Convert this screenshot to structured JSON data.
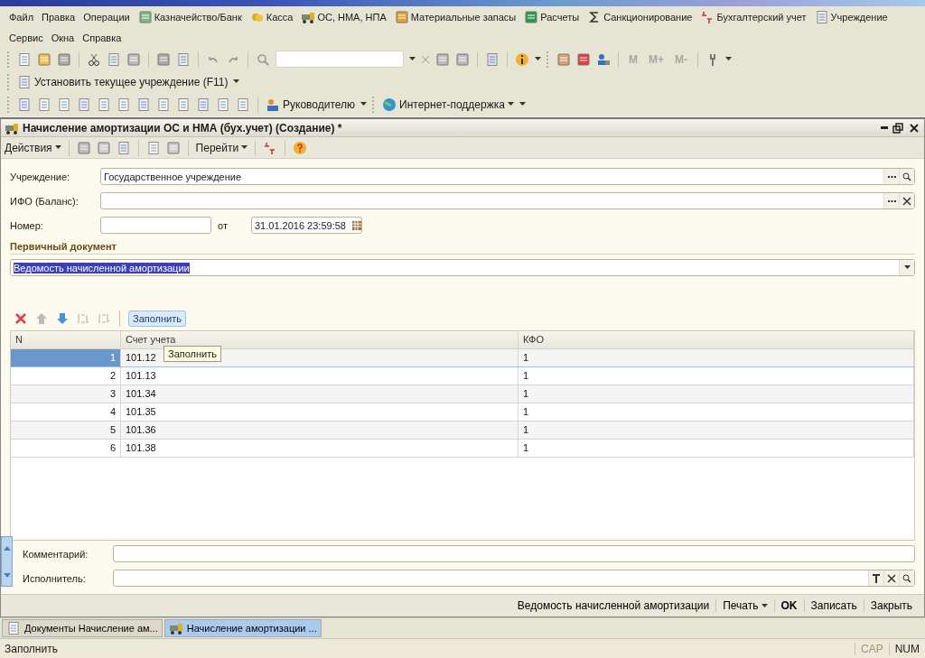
{
  "menu_rows": [
    [
      {
        "label": "Файл"
      },
      {
        "label": "Правка"
      },
      {
        "label": "Операции"
      },
      {
        "label": "Казначейство/Банк"
      },
      {
        "label": "Касса"
      },
      {
        "label": "ОС, НМА, НПА"
      },
      {
        "label": "Материальные запасы"
      },
      {
        "label": "Расчеты"
      },
      {
        "label": "Санкционирование"
      },
      {
        "label": "Бухгалтерский учет"
      },
      {
        "label": "Учреждение"
      }
    ],
    [
      {
        "label": "Сервис"
      },
      {
        "label": "Окна"
      },
      {
        "label": "Справка"
      }
    ]
  ],
  "memory_buttons": [
    {
      "label": "M",
      "disabled": true
    },
    {
      "label": "M+",
      "disabled": true
    },
    {
      "label": "M-",
      "disabled": true
    }
  ],
  "institution_toolbar": {
    "label": "Установить текущее учреждение (F11)"
  },
  "reports_toolbar": {
    "manager_button": "Руководителю",
    "support_button": "Интернет-поддержка"
  },
  "document": {
    "title": "Начисление амортизации ОС и НМА (бух.учет) (Создание) *",
    "toolbar": {
      "actions": "Действия",
      "goto": "Перейти"
    },
    "fields": [
      {
        "label": "Учреждение:",
        "value": "Государственное учреждение",
        "kind": "select"
      },
      {
        "label": "ИФО (Баланс):",
        "kind": "select"
      }
    ],
    "number_label": "Номер:",
    "date_label": "от",
    "date_value": "31.01.2016 23:59:58",
    "section_title": "Первичный документ",
    "primary_document": {
      "value": "Ведомость начисленной амортизации",
      "highlighted": true
    },
    "fill_button": "Заполнить",
    "table": {
      "columns": [
        "N",
        "Счет учета",
        "КФО"
      ],
      "rows": [
        {
          "cells": [
            "1",
            "101.12",
            "1"
          ],
          "selected": true
        },
        {
          "cells": [
            "2",
            "101.13",
            "1"
          ],
          "selected": false
        },
        {
          "cells": [
            "3",
            "101.34",
            "1"
          ],
          "selected": false
        },
        {
          "cells": [
            "4",
            "101.35",
            "1"
          ],
          "selected": false
        },
        {
          "cells": [
            "5",
            "101.36",
            "1"
          ],
          "selected": false
        },
        {
          "cells": [
            "6",
            "101.38",
            "1"
          ],
          "selected": false
        }
      ]
    },
    "tooltip": "Заполнить",
    "comment_label": "Комментарий:",
    "executor_label": "Исполнитель:",
    "bottom_buttons": [
      {
        "label": "Ведомость начисленной амортизации",
        "kind": "link"
      },
      {
        "label": "Печать",
        "kind": "menu"
      },
      {
        "label": "OK",
        "kind": "default"
      },
      {
        "label": "Записать",
        "kind": "link"
      },
      {
        "label": "Закрыть",
        "kind": "link"
      }
    ]
  },
  "taskbar": [
    {
      "label": "Документы Начисление ам...",
      "selected": false
    },
    {
      "label": "Начисление амортизации ...",
      "selected": true
    }
  ],
  "status_bar": {
    "message": "Заполнить",
    "indicators": [
      {
        "label": "CAP",
        "on": false
      },
      {
        "label": "NUM",
        "on": true
      }
    ]
  }
}
